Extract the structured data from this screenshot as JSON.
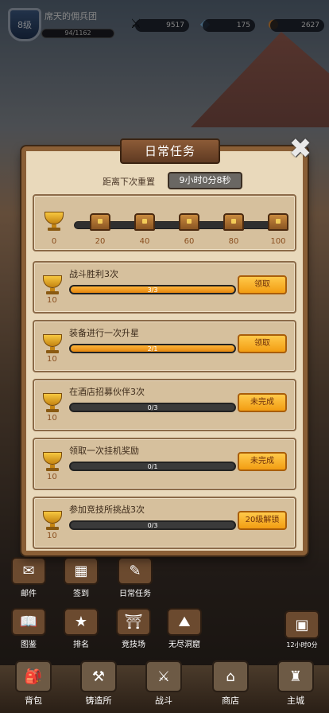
{
  "player": {
    "level": "8级",
    "name": "席天的佣兵团",
    "exp": "94/1162"
  },
  "resources": {
    "power": "9517",
    "gems": "175",
    "coins": "2627"
  },
  "dialog": {
    "title": "日常任务",
    "reset_label": "距离下次重置",
    "reset_time": "9小时0分8秒",
    "progress": {
      "current": "0",
      "milestones": [
        "20",
        "40",
        "60",
        "80",
        "100"
      ]
    },
    "tasks": [
      {
        "title": "战斗胜利3次",
        "progress": "3/3",
        "ratio": 1.0,
        "reward": "10",
        "button": "领取"
      },
      {
        "title": "装备进行一次升星",
        "progress": "2/1",
        "ratio": 1.0,
        "reward": "10",
        "button": "领取"
      },
      {
        "title": "在酒店招募伙伴3次",
        "progress": "0/3",
        "ratio": 0.0,
        "reward": "10",
        "button": "未完成"
      },
      {
        "title": "领取一次挂机奖励",
        "progress": "0/1",
        "ratio": 0.0,
        "reward": "10",
        "button": "未完成"
      },
      {
        "title": "参加竞技所挑战3次",
        "progress": "0/3",
        "ratio": 0.0,
        "reward": "10",
        "button": "20级解锁"
      }
    ]
  },
  "shortcuts": {
    "row1": [
      "邮件",
      "签到",
      "日常任务"
    ],
    "row2": [
      "图鉴",
      "排名",
      "竞技场",
      "无尽洞窟"
    ],
    "chest_timer": "12小时0分"
  },
  "nav": [
    "背包",
    "铸造所",
    "战斗",
    "商店",
    "主城"
  ],
  "colors": {
    "accent": "#f29d12",
    "panel": "#e9d9bb",
    "frame": "#8a5f36"
  }
}
